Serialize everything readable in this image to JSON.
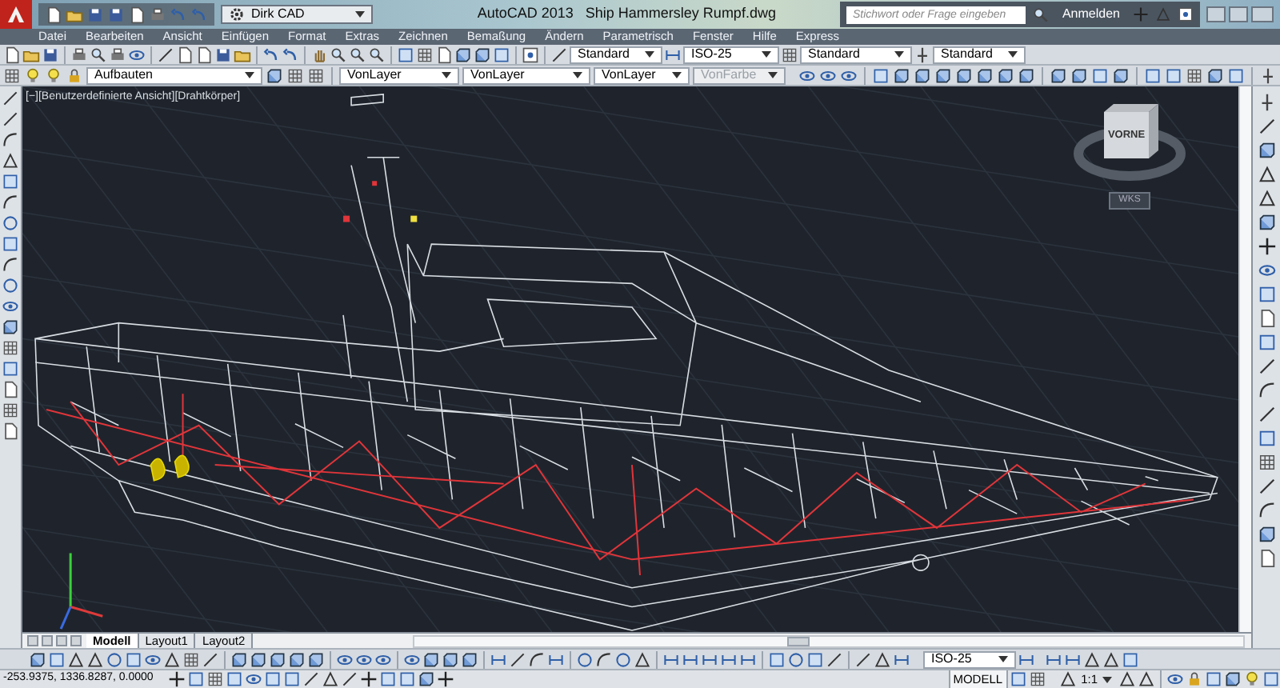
{
  "title_bar": {
    "workspace": "Dirk CAD",
    "app": "AutoCAD 2013",
    "file": "Ship Hammersley Rumpf.dwg",
    "search": {
      "placeholder": "Stichwort oder Frage eingeben"
    },
    "sign_in": "Anmelden"
  },
  "menu": [
    "Datei",
    "Bearbeiten",
    "Ansicht",
    "Einfügen",
    "Format",
    "Extras",
    "Zeichnen",
    "Bemaßung",
    "Ändern",
    "Parametrisch",
    "Fenster",
    "Hilfe",
    "Express"
  ],
  "toolbar_1": {
    "dropdowns": [
      {
        "value": "Standard"
      },
      {
        "value": "ISO-25"
      },
      {
        "value": "Standard"
      },
      {
        "value": "Standard"
      }
    ]
  },
  "toolbar_2": {
    "layer": "Aufbauten",
    "dropdowns": [
      {
        "value": "VonLayer",
        "disabled": false
      },
      {
        "value": "VonLayer",
        "disabled": false
      },
      {
        "value": "VonLayer",
        "disabled": false
      },
      {
        "value": "VonFarbe",
        "disabled": true
      }
    ]
  },
  "viewport": {
    "label": "[−][Benutzerdefinierte Ansicht][Drahtkörper]",
    "viewcube": {
      "face": "VORNE",
      "ucs": "WKS"
    }
  },
  "layout_tabs": [
    {
      "label": "Modell",
      "selected": true
    },
    {
      "label": "Layout1",
      "selected": false
    },
    {
      "label": "Layout2",
      "selected": false
    }
  ],
  "bottom_toolbar": {
    "dimstyle": "ISO-25"
  },
  "status_bar": {
    "coordinates": "-253.9375, 1336.8287, 0.0000",
    "space": "MODELL",
    "scale": "1:1"
  }
}
